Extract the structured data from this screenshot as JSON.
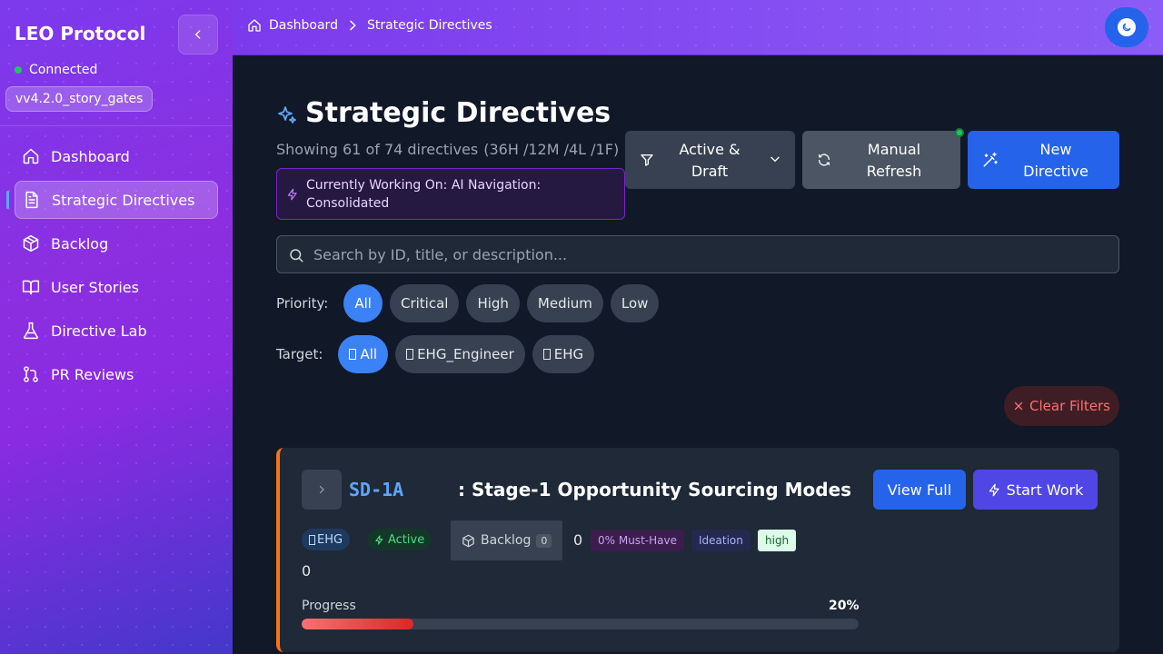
{
  "sidebar": {
    "brand": "LEO Protocol",
    "connection": "Connected",
    "version": "vv4.2.0_story_gates",
    "items": [
      {
        "label": "Dashboard"
      },
      {
        "label": "Strategic Directives"
      },
      {
        "label": "Backlog"
      },
      {
        "label": "User Stories"
      },
      {
        "label": "Directive Lab"
      },
      {
        "label": "PR Reviews"
      }
    ]
  },
  "breadcrumb": {
    "home": "Dashboard",
    "current": "Strategic Directives"
  },
  "page": {
    "title": "Strategic Directives",
    "summary": "Showing 61 of 74 directives",
    "summary_counts": "(36H /12M /4L /1F)",
    "working_on": "Currently Working On: AI Navigation: Consolidated"
  },
  "toolbar": {
    "filter_label": "Active & Draft",
    "refresh_label": "Manual Refresh",
    "new_label": "New Directive"
  },
  "search": {
    "placeholder": "Search by ID, title, or description...",
    "value": ""
  },
  "filters": {
    "priority_label": "Priority:",
    "priority_options": [
      "All",
      "Critical",
      "High",
      "Medium",
      "Low"
    ],
    "priority_selected": "All",
    "target_label": "Target:",
    "target_options": [
      "All",
      "EHG_Engineer",
      "EHG"
    ],
    "target_selected": "All",
    "clear_label": "Clear Filters"
  },
  "directive": {
    "id": "SD-1A",
    "title": ": Stage-1 Opportunity Sourcing Modes",
    "view_label": "View Full",
    "start_label": "Start Work",
    "target": "EHG",
    "status": "Active",
    "backlog_label": "Backlog",
    "backlog_count": "0",
    "zero_a": "0",
    "zero_b": "0",
    "must_have": "0% Must-Have",
    "stage": "Ideation",
    "priority": "high",
    "progress_label": "Progress",
    "progress_text": "20%",
    "progress": 0.2
  },
  "colors": {
    "accent": "#2563eb",
    "card_border": "#f97316",
    "status_green": "#22c55e"
  }
}
